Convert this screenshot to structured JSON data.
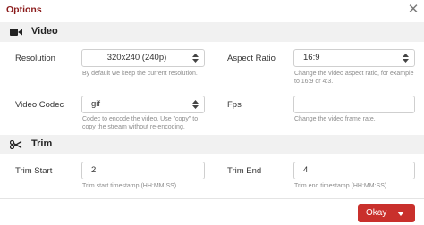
{
  "dialog": {
    "title": "Options",
    "close_glyph": "✕"
  },
  "video": {
    "heading": "Video",
    "icon": "video-camera-icon",
    "resolution": {
      "label": "Resolution",
      "value": "320x240 (240p)",
      "help": "By default we keep the current resolution."
    },
    "aspect_ratio": {
      "label": "Aspect Ratio",
      "value": "16:9",
      "help": "Change the video aspect ratio, for example to 16:9 or 4:3."
    },
    "codec": {
      "label": "Video Codec",
      "value": "gif",
      "help": "Codec to encode the video. Use \"copy\" to copy the stream without re-encoding."
    },
    "fps": {
      "label": "Fps",
      "value": "",
      "help": "Change the video frame rate."
    }
  },
  "trim": {
    "heading": "Trim",
    "icon": "scissors-icon",
    "start": {
      "label": "Trim Start",
      "value": "2",
      "help": "Trim start timestamp (HH:MM:SS)"
    },
    "end": {
      "label": "Trim End",
      "value": "4",
      "help": "Trim end timestamp (HH:MM:SS)"
    }
  },
  "footer": {
    "ok_label": "Okay"
  },
  "colors": {
    "accent": "#c9302c",
    "title": "#8b1c1c",
    "section_bg": "#f1f1f1"
  }
}
